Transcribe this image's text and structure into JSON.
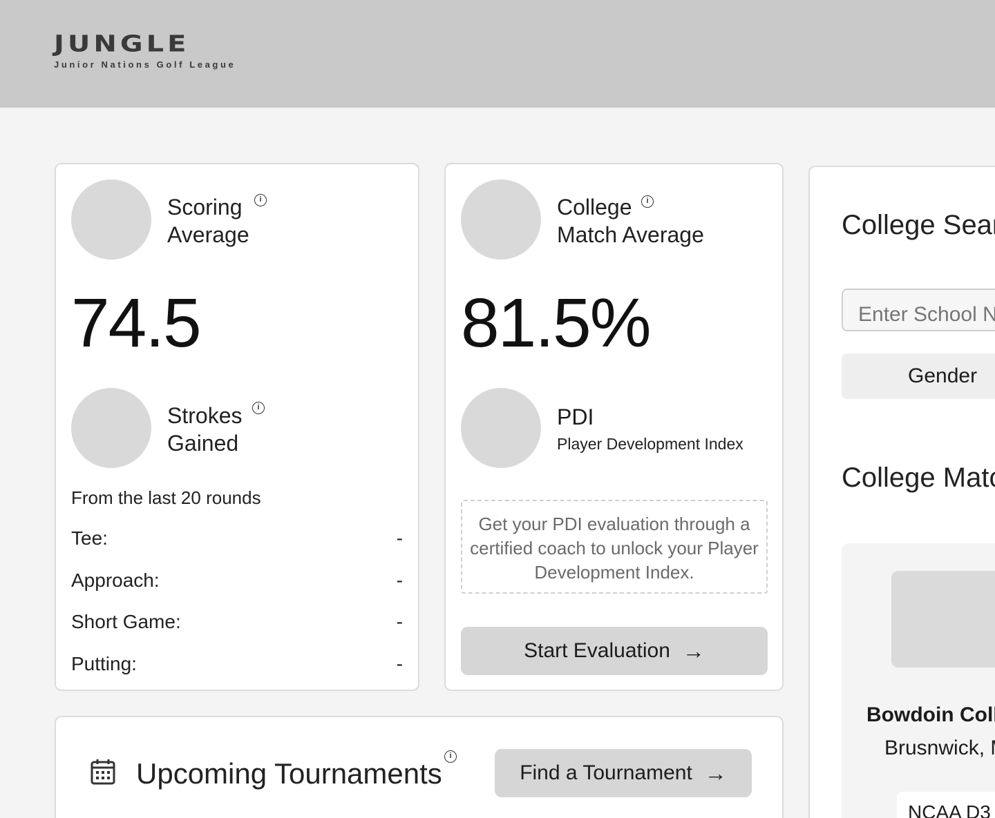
{
  "header": {
    "logo_word": "JUNGLE",
    "logo_tagline": "Junior Nations Golf League"
  },
  "scoring": {
    "label_line1": "Scoring",
    "label_line2": "Average",
    "value": "74.5",
    "sg_label_line1": "Strokes",
    "sg_label_line2": "Gained",
    "sg_note": "From the last 20 rounds",
    "rows": [
      {
        "label": "Tee:",
        "value": "-"
      },
      {
        "label": "Approach:",
        "value": "-"
      },
      {
        "label": "Short Game:",
        "value": "-"
      },
      {
        "label": "Putting:",
        "value": "-"
      }
    ]
  },
  "college": {
    "label_line1": "College",
    "label_line2": "Match Average",
    "value": "81.5%",
    "pdi_title": "PDI",
    "pdi_subtitle": "Player Development Index",
    "pdi_message": "Get your PDI evaluation through a certified coach to unlock your Player Development Index.",
    "eval_button": "Start Evaluation"
  },
  "search": {
    "title": "College Search",
    "input_placeholder": "Enter School Name",
    "gender_label": "Gender",
    "match_title": "College Matches",
    "match": {
      "school_name": "Bowdoin College",
      "location": "Brusnwick, ME",
      "division": "NCAA D3"
    }
  },
  "tournaments": {
    "title": "Upcoming Tournaments",
    "find_button": "Find a Tournament"
  },
  "icons": {
    "info": "info-icon",
    "arrow": "arrow-right-icon",
    "calendar": "calendar-icon"
  },
  "colors": {
    "header_bg": "#c9c9c9",
    "page_bg": "#f4f4f4",
    "placeholder_circle": "#d9d9d9",
    "button_bg": "#d6d6d6"
  }
}
